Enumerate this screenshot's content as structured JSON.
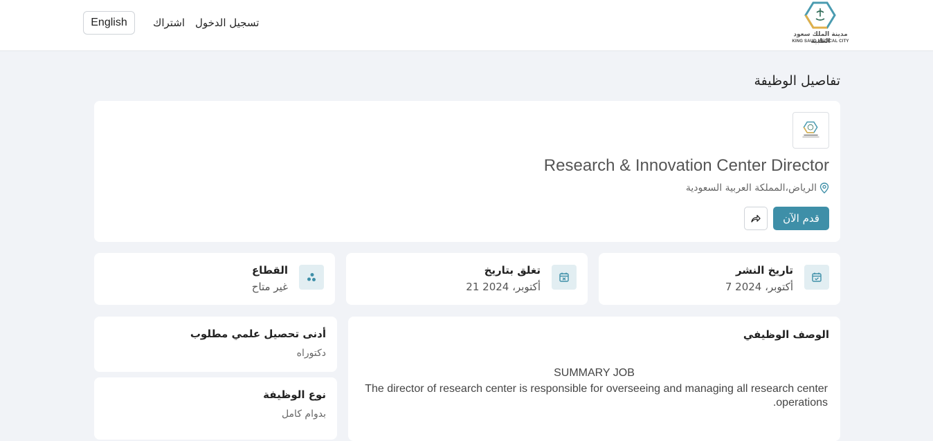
{
  "header": {
    "language_button": "English",
    "subscribe_link": "اشتراك",
    "login_link": "تسجيل الدخول",
    "logo": {
      "name_ar": "مدينة الملك سعود الطبية",
      "name_en": "KING SAUD MEDICAL CITY"
    }
  },
  "page": {
    "title": "تفاصيل الوظيفة"
  },
  "job": {
    "title": "Research & Innovation Center Director",
    "location": "الرياض،المملكة العربية السعودية",
    "apply_button": "قدم الآن"
  },
  "stats": [
    {
      "label": "تاريخ النشر",
      "value": "7 أكتوبر، 2024",
      "icon": "calendar-check-icon"
    },
    {
      "label": "تغلق بتاريخ",
      "value": "21 أكتوبر، 2024",
      "icon": "calendar-x-icon"
    },
    {
      "label": "القطاع",
      "value": "غير متاح",
      "icon": "sector-icon"
    }
  ],
  "description": {
    "heading": "الوصف الوظيفي",
    "summary_title": "SUMMARY JOB",
    "text": "The director of research center is responsible for overseeing and managing all research center operations."
  },
  "education": {
    "heading": "أدنى تحصيل علمي مطلوب",
    "value": "دكتوراه"
  },
  "job_type": {
    "heading": "نوع الوظيفة",
    "value": "بدوام كامل"
  },
  "colors": {
    "accent": "#3e8fa8",
    "background": "#f1f3f7",
    "icon_bg": "#e2eef2"
  }
}
